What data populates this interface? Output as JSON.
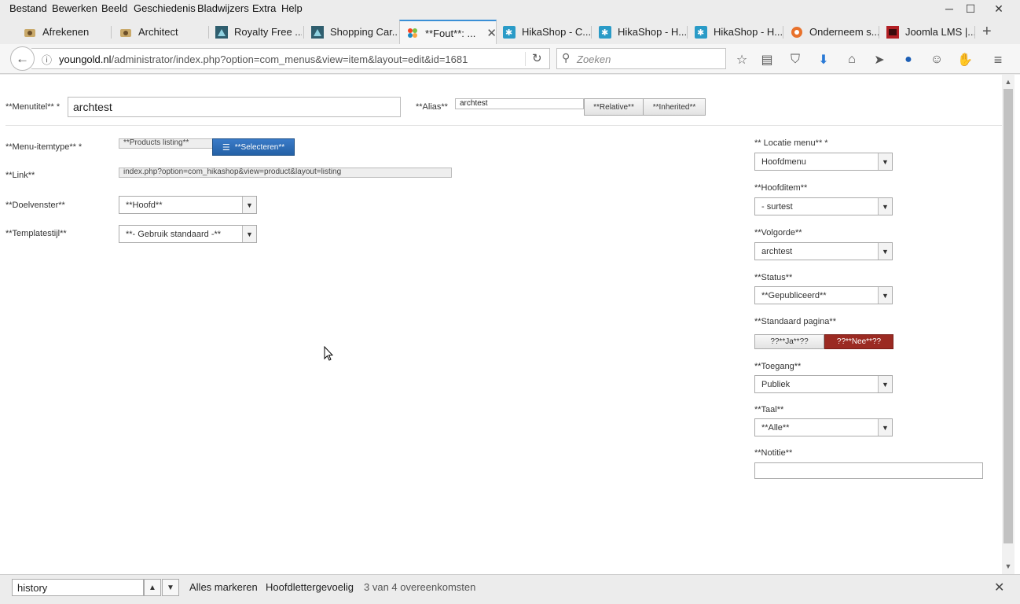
{
  "menubar": {
    "items": [
      "Bestand",
      "Bewerken",
      "Beeld",
      "Geschiedenis",
      "Bladwijzers",
      "Extra",
      "Help"
    ]
  },
  "window": {
    "minimize": "─",
    "maximize": "☐",
    "close": "✕"
  },
  "tabs": [
    {
      "title": "Afrekenen",
      "icon": "shop-icon"
    },
    {
      "title": "Architect",
      "icon": "shop-icon"
    },
    {
      "title": "Royalty Free ...",
      "icon": "photo-icon"
    },
    {
      "title": "Shopping Car...",
      "icon": "photo-icon"
    },
    {
      "title": "**Fout**: ...",
      "icon": "joomla-icon",
      "active": true
    },
    {
      "title": "HikaShop - C...",
      "icon": "hikashop-icon"
    },
    {
      "title": "HikaShop - H...",
      "icon": "hikashop-icon"
    },
    {
      "title": "HikaShop - H...",
      "icon": "hikashop-icon"
    },
    {
      "title": "Onderneem s...",
      "icon": "globe-icon"
    },
    {
      "title": "Joomla LMS |...",
      "icon": "lms-icon"
    }
  ],
  "navbar": {
    "url_domain": "youngold.nl",
    "url_path": "/administrator/index.php?option=com_menus&view=item&layout=edit&id=1681",
    "search_placeholder": "Zoeken"
  },
  "form": {
    "menutitel_label": "**Menutitel** *",
    "menutitel_value": "archtest",
    "alias_label": "**Alias**",
    "alias_value": "archtest",
    "relative_label": "**Relative**",
    "inherited_label": "**Inherited**",
    "itemtype_label": "**Menu-itemtype** *",
    "itemtype_value": "**Products listing**",
    "selecteren_label": "**Selecteren**",
    "link_label": "**Link**",
    "link_value": "index.php?option=com_hikashop&view=product&layout=listing",
    "doelvenster_label": "**Doelvenster**",
    "doelvenster_value": "**Hoofd**",
    "templatestijl_label": "**Templatestijl**",
    "templatestijl_value": "**- Gebruik standaard -**"
  },
  "sidebar": {
    "locatie_label": "** Locatie menu** *",
    "locatie_value": "Hoofdmenu",
    "hoofditem_label": "**Hoofditem**",
    "hoofditem_value": "- surtest",
    "volgorde_label": "**Volgorde**",
    "volgorde_value": "archtest",
    "status_label": "**Status**",
    "status_value": "**Gepubliceerd**",
    "standaard_label": "**Standaard pagina**",
    "ja_label": "??**Ja**??",
    "nee_label": "??**Nee**??",
    "toegang_label": "**Toegang**",
    "toegang_value": "Publiek",
    "taal_label": "**Taal**",
    "taal_value": "**Alle**",
    "notitie_label": "**Notitie**",
    "notitie_value": ""
  },
  "findbar": {
    "query": "history",
    "highlight_all": "Alles markeren",
    "match_case": "Hoofdlettergevoelig",
    "status": "3 van 4 overeenkomsten"
  },
  "colors": {
    "accent_blue": "#2a6eb3",
    "nee_red": "#9b2a22",
    "tab_active_border": "#3a8fd6"
  }
}
